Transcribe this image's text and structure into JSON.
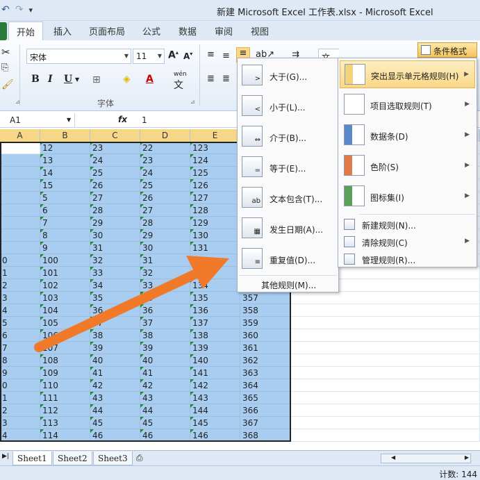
{
  "window": {
    "title": "新建 Microsoft Excel 工作表.xlsx  -  Microsoft Excel"
  },
  "tabs": [
    "开始",
    "插入",
    "页面布局",
    "公式",
    "数据",
    "审阅",
    "视图"
  ],
  "ribbon": {
    "font_name": "宋体",
    "font_size": "11",
    "font_group_label": "字体",
    "number_format": "文本",
    "conditional_format_label": "条件格式",
    "wen_label": "wén"
  },
  "formula_bar": {
    "name_box": "A1",
    "fx": "fx",
    "value": "1"
  },
  "columns": [
    "A",
    "B",
    "C",
    "D",
    "E"
  ],
  "rows": [
    [
      "",
      "12",
      "23",
      "22",
      "123"
    ],
    [
      "",
      "13",
      "24",
      "23",
      "124"
    ],
    [
      "",
      "14",
      "25",
      "24",
      "125"
    ],
    [
      "",
      "15",
      "26",
      "25",
      "126"
    ],
    [
      "",
      "5",
      "27",
      "26",
      "127"
    ],
    [
      "",
      "6",
      "28",
      "27",
      "128"
    ],
    [
      "",
      "7",
      "29",
      "28",
      "129"
    ],
    [
      "",
      "8",
      "30",
      "29",
      "130"
    ],
    [
      "",
      "9",
      "31",
      "30",
      "131"
    ],
    [
      "0",
      "100",
      "32",
      "31",
      "",
      ""
    ],
    [
      "1",
      "101",
      "33",
      "32",
      "",
      ""
    ],
    [
      "2",
      "102",
      "34",
      "33",
      "134",
      ""
    ],
    [
      "3",
      "103",
      "35",
      "35",
      "135",
      "357"
    ],
    [
      "4",
      "104",
      "36",
      "36",
      "136",
      "358"
    ],
    [
      "5",
      "105",
      "37",
      "37",
      "137",
      "359"
    ],
    [
      "6",
      "106",
      "38",
      "38",
      "138",
      "360"
    ],
    [
      "7",
      "107",
      "39",
      "39",
      "139",
      "361"
    ],
    [
      "8",
      "108",
      "40",
      "40",
      "140",
      "362"
    ],
    [
      "9",
      "109",
      "41",
      "41",
      "141",
      "363"
    ],
    [
      "0",
      "110",
      "42",
      "42",
      "142",
      "364"
    ],
    [
      "1",
      "111",
      "43",
      "43",
      "143",
      "365"
    ],
    [
      "2",
      "112",
      "44",
      "44",
      "144",
      "366"
    ],
    [
      "3",
      "113",
      "45",
      "45",
      "145",
      "367"
    ],
    [
      "4",
      "114",
      "46",
      "46",
      "146",
      "368"
    ]
  ],
  "sheets": [
    "Sheet1",
    "Sheet2",
    "Sheet3"
  ],
  "status": {
    "count": "计数: 144"
  },
  "highlight_menu": {
    "items": [
      "大于(G)...",
      "小于(L)...",
      "介于(B)...",
      "等于(E)...",
      "文本包含(T)...",
      "发生日期(A)...",
      "重复值(D)..."
    ],
    "more": "其他规则(M)..."
  },
  "cf_menu": {
    "items": [
      "突出显示单元格规则(H)",
      "项目选取规则(T)",
      "数据条(D)",
      "色阶(S)",
      "图标集(I)"
    ],
    "small_items": [
      "新建规则(N)...",
      "清除规则(C)",
      "管理规则(R)..."
    ]
  },
  "colors": {
    "selection": "#a9cdf0",
    "menu_highlight": "#fbd886",
    "arrow": "#f07a2a",
    "error_triangle": "#1a8a2a"
  }
}
